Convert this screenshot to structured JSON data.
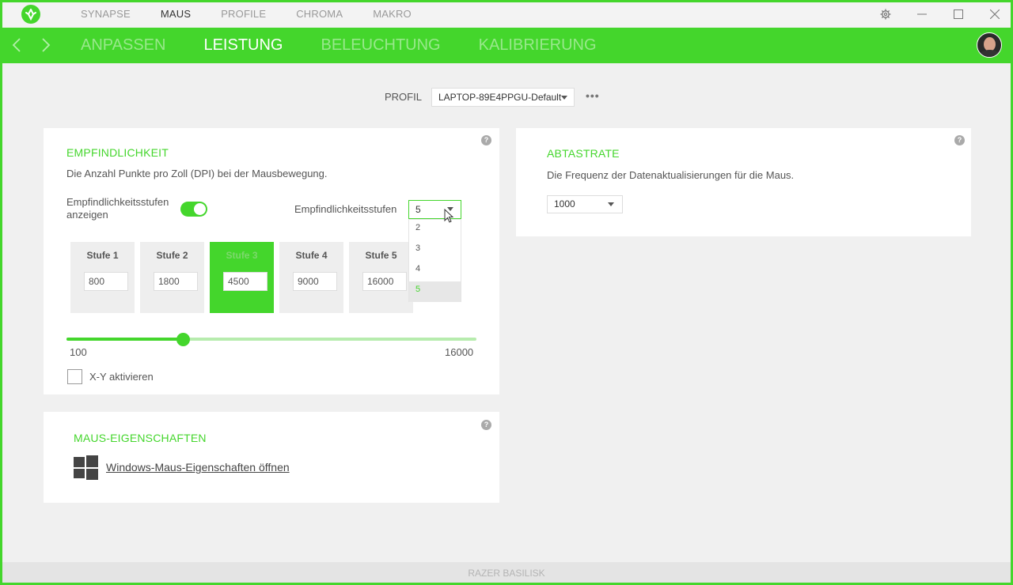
{
  "colors": {
    "accent": "#44d62c",
    "background": "#f0f0f0",
    "panel": "#ffffff"
  },
  "topnav": {
    "items": [
      "SYNAPSE",
      "MAUS",
      "PROFILE",
      "CHROMA",
      "MAKRO"
    ],
    "active": "MAUS"
  },
  "subnav": {
    "items": [
      "ANPASSEN",
      "LEISTUNG",
      "BELEUCHTUNG",
      "KALIBRIERUNG"
    ],
    "active": "LEISTUNG"
  },
  "icons": [
    "razer-logo-icon",
    "gear-icon",
    "minimize-icon",
    "maximize-icon",
    "close-icon",
    "back-arrow-icon",
    "forward-arrow-icon",
    "help-icon",
    "windows-logo-icon",
    "avatar"
  ],
  "profile": {
    "label": "PROFIL",
    "value": "LAPTOP-89E4PPGU-Default",
    "more": "•••"
  },
  "sensitivity": {
    "title": "EMPFINDLICHKEIT",
    "description": "Die Anzahl Punkte pro Zoll (DPI) bei der Mausbewegung.",
    "toggle_label_line1": "Empfindlichkeitsstufen",
    "toggle_label_line2": "anzeigen",
    "toggle_on": true,
    "stages_label": "Empfindlichkeitsstufen",
    "stages_value": "5",
    "stages_options": [
      "2",
      "3",
      "4",
      "5"
    ],
    "stages": [
      {
        "label": "Stufe 1",
        "value": "800"
      },
      {
        "label": "Stufe 2",
        "value": "1800"
      },
      {
        "label": "Stufe 3",
        "value": "4500",
        "active": true
      },
      {
        "label": "Stufe 4",
        "value": "9000"
      },
      {
        "label": "Stufe 5",
        "value": "16000"
      }
    ],
    "slider_min": "100",
    "slider_max": "16000",
    "slider_value": 4500,
    "xy_label": "X-Y aktivieren"
  },
  "polling": {
    "title": "ABTASTRATE",
    "description": "Die Frequenz der Datenaktualisierungen für die Maus.",
    "value": "1000"
  },
  "mouse_props": {
    "title": "MAUS-EIGENSCHAFTEN",
    "link": "Windows-Maus-Eigenschaften öffnen"
  },
  "help_glyph": "?",
  "statusbar": {
    "device": "RAZER BASILISK"
  }
}
